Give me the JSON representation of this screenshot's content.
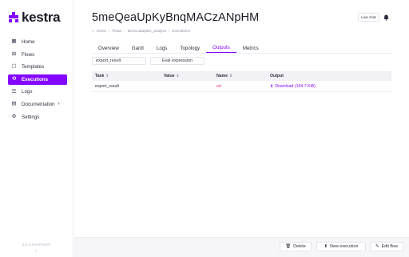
{
  "brand": {
    "name": "kestra"
  },
  "sidebar": {
    "items": [
      {
        "label": "Home",
        "icon": "dashboard-icon",
        "glyph": "▦"
      },
      {
        "label": "Flows",
        "icon": "flows-icon",
        "glyph": "⊞"
      },
      {
        "label": "Templates",
        "icon": "templates-icon",
        "glyph": "▢"
      },
      {
        "label": "Executions",
        "icon": "executions-icon",
        "glyph": "⟲",
        "active": true
      },
      {
        "label": "Logs",
        "icon": "logs-icon",
        "glyph": "☰"
      },
      {
        "label": "Documentation",
        "icon": "documentation-icon",
        "glyph": "▤",
        "has_children": true
      },
      {
        "label": "Settings",
        "icon": "settings-icon",
        "glyph": "⚙"
      }
    ],
    "version": "0.6.1-SNAPSHOT",
    "collapse_glyph": "‹"
  },
  "header": {
    "title": "5meQeaUpKyBnqMACzANpHM",
    "breadcrumb": [
      "Home",
      "Flows",
      "demo.adaptive_analyze",
      "Executions"
    ],
    "live_chat": "Live chat"
  },
  "tabs": [
    {
      "label": "Overview"
    },
    {
      "label": "Gantt"
    },
    {
      "label": "Logs"
    },
    {
      "label": "Topology"
    },
    {
      "label": "Outputs",
      "active": true
    },
    {
      "label": "Metrics"
    }
  ],
  "filters": {
    "task_select_value": "export_result",
    "eval_button": "Eval expression"
  },
  "table": {
    "columns": [
      "Task",
      "Value",
      "Name",
      "Output"
    ],
    "rows": [
      {
        "task": "export_result",
        "value": "",
        "name": "uri",
        "output": "Download (164.7 KiB)"
      }
    ]
  },
  "footer": {
    "delete": "Delete",
    "new_execution": "New execution",
    "edit_flow": "Edit flow"
  },
  "colors": {
    "accent": "#8405ff",
    "name_value": "#e0245e"
  }
}
